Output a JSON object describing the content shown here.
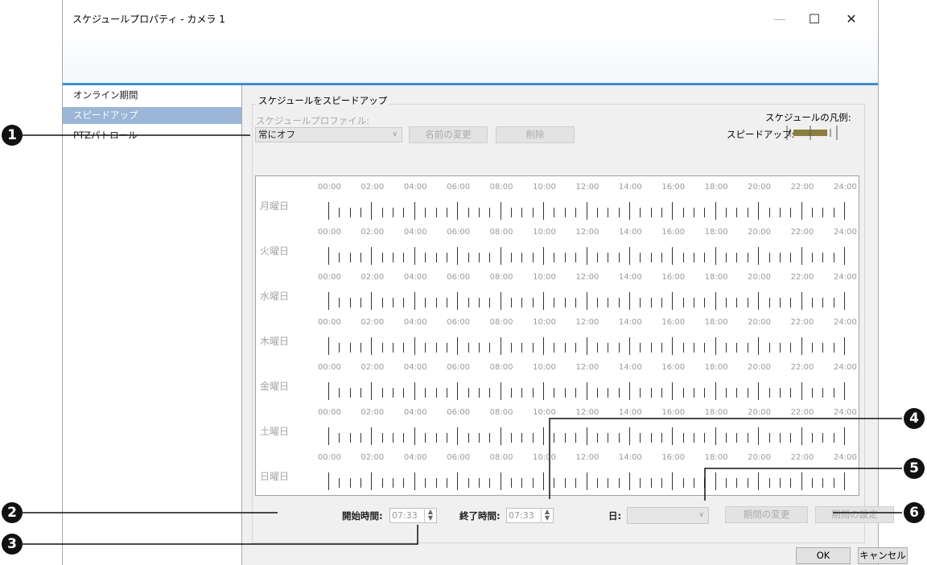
{
  "window": {
    "title": "スケジュールプロパティ - カメラ 1",
    "minimize_icon": "minimize-icon",
    "maximize_icon": "maximize-icon",
    "close_icon": "close-icon",
    "accent_color": "#3c8fd0"
  },
  "sidebar": {
    "items": [
      {
        "label": "オンライン期間",
        "selected": false
      },
      {
        "label": "スピードアップ",
        "selected": true
      },
      {
        "label": "PTZパトロール",
        "selected": false
      }
    ]
  },
  "group": {
    "title": "スケジュールをスピードアップ",
    "profile_label": "スケジュールプロファイル:",
    "profile_value": "常にオフ",
    "rename_button": "名前の変更",
    "delete_button": "削除",
    "legend_title": "スケジュールの凡例:",
    "legend_label": "スピードアップ:",
    "legend_color": "#8b7e3d"
  },
  "schedule": {
    "days": [
      "月曜日",
      "火曜日",
      "水曜日",
      "木曜日",
      "金曜日",
      "土曜日",
      "日曜日"
    ],
    "times": [
      "00:00",
      "02:00",
      "04:00",
      "06:00",
      "08:00",
      "10:00",
      "12:00",
      "14:00",
      "16:00",
      "18:00",
      "20:00",
      "22:00",
      "24:00"
    ]
  },
  "controls": {
    "start_label": "開始時間:",
    "start_value": "07:33",
    "end_label": "終了時間:",
    "end_value": "07:33",
    "day_label": "日:",
    "day_value": "",
    "change_period_button": "期間の変更",
    "set_period_button": "期間の設定",
    "ok_button": "OK",
    "cancel_button": "キャンセル"
  },
  "callouts": [
    "1",
    "2",
    "3",
    "4",
    "5",
    "6"
  ]
}
